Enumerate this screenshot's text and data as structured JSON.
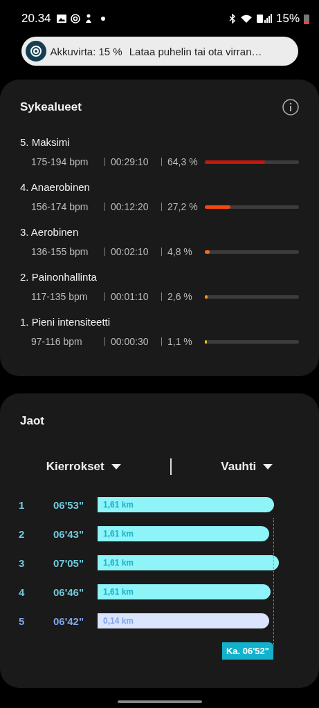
{
  "status_bar": {
    "time": "20.34",
    "battery": "15%"
  },
  "notification": {
    "title": "Akkuvirta: 15 %",
    "text": "Lataa puhelin tai ota virran…"
  },
  "heart_rate_zones": {
    "title": "Sykealueet",
    "zones": [
      {
        "name": "5. Maksimi",
        "range": "175-194 bpm",
        "duration": "00:29:10",
        "percent": "64,3 %",
        "level": 0.643,
        "color": "#c4170e"
      },
      {
        "name": "4. Anaerobinen",
        "range": "156-174 bpm",
        "duration": "00:12:20",
        "percent": "27,2 %",
        "level": 0.272,
        "color": "#f4480f"
      },
      {
        "name": "3. Aerobinen",
        "range": "136-155 bpm",
        "duration": "00:02:10",
        "percent": "4,8 %",
        "level": 0.048,
        "color": "#f5700f"
      },
      {
        "name": "2. Painonhallinta",
        "range": "117-135 bpm",
        "duration": "00:01:10",
        "percent": "2,6 %",
        "level": 0.026,
        "color": "#f5960f"
      },
      {
        "name": "1. Pieni intensiteetti",
        "range": "97-116 bpm",
        "duration": "00:00:30",
        "percent": "1,1 %",
        "level": 0.011,
        "color": "#f2c20c"
      }
    ]
  },
  "splits": {
    "title": "Jaot",
    "dropdowns": [
      {
        "label": "Kierrokset"
      },
      {
        "label": "Vauhti"
      }
    ],
    "laps": [
      {
        "number": "1",
        "pace": "06'53\"",
        "distance": "1,61 km",
        "kind": "full"
      },
      {
        "number": "2",
        "pace": "06'43\"",
        "distance": "1,61 km",
        "kind": "full"
      },
      {
        "number": "3",
        "pace": "07'05\"",
        "distance": "1,61 km",
        "kind": "full"
      },
      {
        "number": "4",
        "pace": "06'46\"",
        "distance": "1,61 km",
        "kind": "full"
      },
      {
        "number": "5",
        "pace": "06'42\"",
        "distance": "0,14 km",
        "kind": "partial"
      }
    ],
    "average": {
      "label": "Ka. 06'52\""
    }
  }
}
